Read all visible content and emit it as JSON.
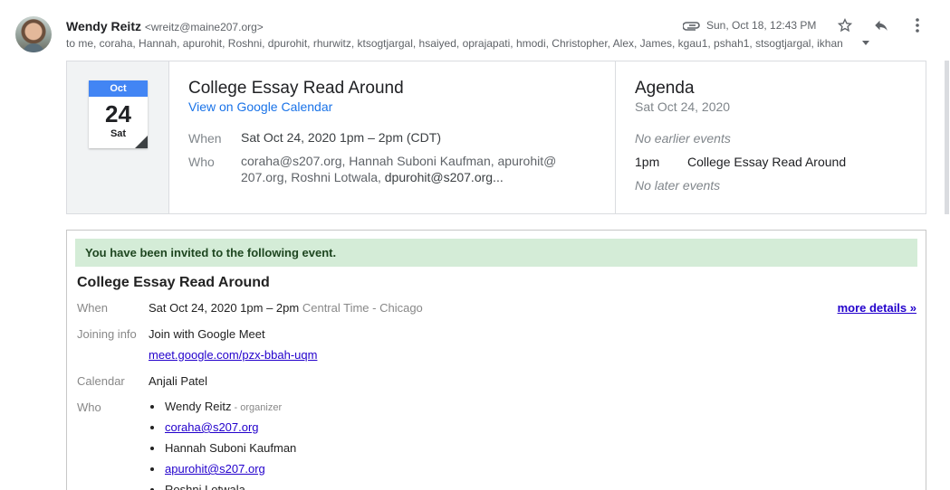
{
  "header": {
    "sender_name": "Wendy Reitz",
    "sender_email": "<wreitz@maine207.org>",
    "recipients": "to me, coraha, Hannah, apurohit, Roshni, dpurohit, rhurwitz, ktsogtjargal, hsaiyed, oprajapati, hmodi, Christopher, Alex, James, kgau1, pshah1, stsogtjargal, ikhan",
    "date": "Sun, Oct 18, 12:43 PM",
    "icons": [
      "paperclip-icon",
      "star-icon",
      "reply-icon",
      "more-vert-icon"
    ]
  },
  "card": {
    "cal_month": "Oct",
    "cal_day": "24",
    "cal_weekday": "Sat",
    "title": "College Essay Read Around",
    "gcal_link": "View on Google Calendar",
    "when_label": "When",
    "when_value": "Sat Oct 24, 2020 1pm – 2pm (CDT)",
    "who_label": "Who",
    "who_line1_part1": "coraha@s207.org, Hannah Suboni Kaufman, apurohit@",
    "who_line2_part1": "207.org, Roshni Lotwala,",
    "who_line2_part2": " dpurohit@s207.org..."
  },
  "agenda": {
    "title": "Agenda",
    "date": "Sat Oct 24, 2020",
    "no_earlier": "No earlier events",
    "time": "1pm",
    "event": "College Essay Read Around",
    "no_later": "No later events"
  },
  "invite": {
    "banner": "You have been invited to the following event.",
    "title": "College Essay Read Around",
    "when_label": "When",
    "when_value": "Sat Oct 24, 2020 1pm – 2pm",
    "timezone": "Central Time - Chicago",
    "more_details": "more details »",
    "joining_label": "Joining info",
    "joining_value": "Join with Google Meet",
    "meet_link": "meet.google.com/pzx-bbah-uqm",
    "calendar_label": "Calendar",
    "calendar_value": "Anjali Patel",
    "who_label": "Who",
    "who": [
      {
        "name": "Wendy Reitz",
        "role": " - organizer"
      },
      {
        "name": "coraha@s207.org"
      },
      {
        "name": "Hannah Suboni Kaufman"
      },
      {
        "name": "apurohit@s207.org"
      },
      {
        "name": "Roshni Lotwala"
      }
    ]
  },
  "colors": {
    "accent": "#4285f4",
    "link": "#1a73e8",
    "banner_bg": "#d4ecd7"
  }
}
